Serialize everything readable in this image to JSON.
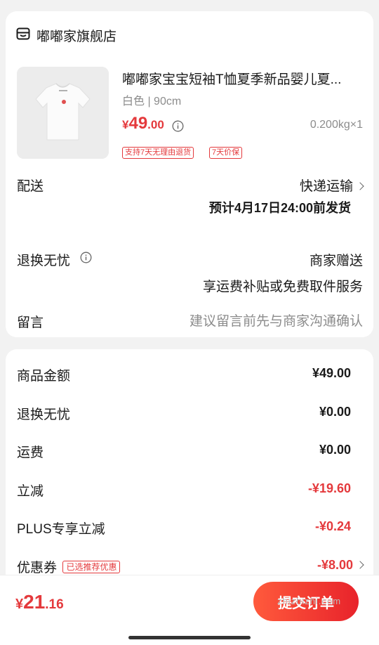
{
  "store": {
    "name": "嘟嘟家旗舰店",
    "icon": "store-icon"
  },
  "product": {
    "title": "嘟嘟家宝宝短袖T恤夏季新品婴儿夏...",
    "spec": "白色 | 90cm",
    "price_symbol": "¥",
    "price_int": "49",
    "price_dec": ".00",
    "weight_qty": "0.200kg×1",
    "tags": [
      "支持7天无理由退货",
      "7天价保"
    ]
  },
  "delivery": {
    "label": "配送",
    "method": "快递运输",
    "eta": "预计4月17日24:00前发货"
  },
  "return_service": {
    "label": "退换无忧",
    "value": "商家赠送",
    "desc": "享运费补贴或免费取件服务"
  },
  "message": {
    "label": "留言",
    "placeholder": "建议留言前先与商家沟通确认"
  },
  "fees": [
    {
      "label": "商品金额",
      "value": "¥49.00",
      "emphasis": "normal"
    },
    {
      "label": "退换无忧",
      "value": "¥0.00",
      "emphasis": "normal"
    },
    {
      "label": "运费",
      "value": "¥0.00",
      "emphasis": "normal"
    },
    {
      "label": "立减",
      "value": "-¥19.60",
      "emphasis": "red"
    },
    {
      "label": "PLUS专享立减",
      "value": "-¥0.24",
      "emphasis": "red"
    },
    {
      "label": "优惠券",
      "value": "-¥8.00",
      "emphasis": "red",
      "badge": "已选推荐优惠"
    }
  ],
  "bottom": {
    "total_symbol": "¥",
    "total_int": "21",
    "total_dec": ".16",
    "submit_label": "提交订单"
  },
  "watermark": "zhizhizhi.com",
  "colors": {
    "accent": "#e4393c",
    "muted": "#8c8c8c",
    "background": "#f2f2f2"
  }
}
